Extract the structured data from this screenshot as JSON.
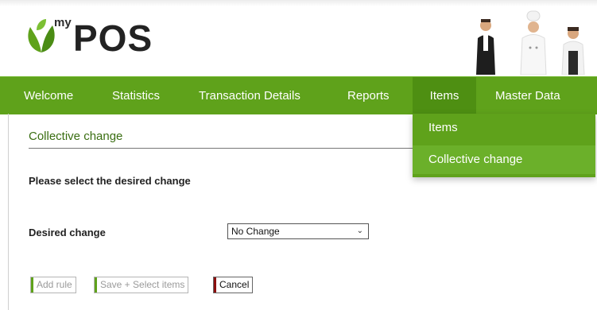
{
  "header": {
    "logo_my": "my",
    "logo_pos": "POS"
  },
  "nav": {
    "items": [
      {
        "label": "Welcome"
      },
      {
        "label": "Statistics"
      },
      {
        "label": "Transaction Details"
      },
      {
        "label": "Reports"
      },
      {
        "label": "Items"
      },
      {
        "label": "Master Data"
      }
    ]
  },
  "dropdown": {
    "items": [
      {
        "label": "Items"
      },
      {
        "label": "Collective change"
      }
    ]
  },
  "main": {
    "section_title": "Collective change",
    "instruction": "Please select the desired change",
    "desired_change_label": "Desired change",
    "desired_change_value": "No Change"
  },
  "buttons": {
    "add_rule": "Add rule",
    "save_select": "Save + Select items",
    "cancel": "Cancel"
  },
  "colors": {
    "nav_green": "#5fa21b",
    "active_green": "#4e8f12",
    "title_green": "#3a6e12",
    "cancel_accent": "#8b0f0f"
  }
}
